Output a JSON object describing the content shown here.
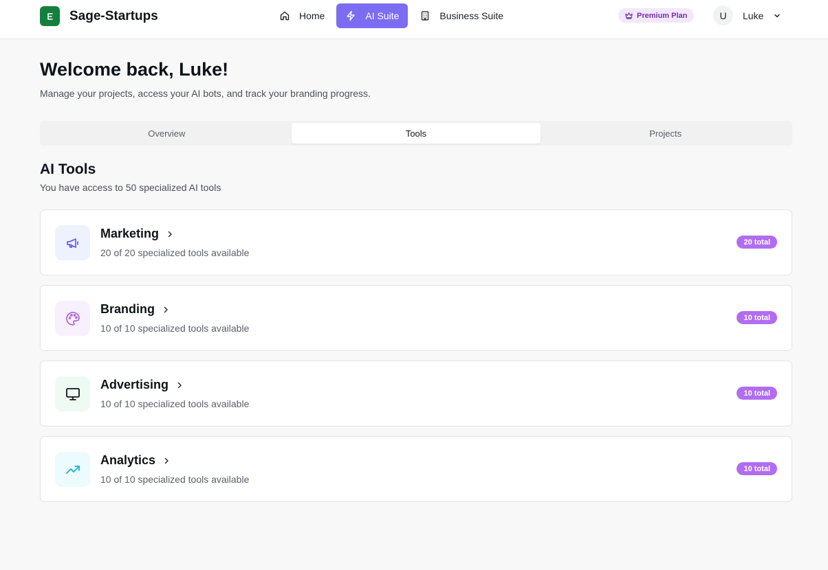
{
  "app": {
    "name": "Sage-Startups"
  },
  "nav": {
    "items": [
      {
        "label": "Home",
        "icon": "home-icon",
        "active": false
      },
      {
        "label": "AI Suite",
        "icon": "lightning-icon",
        "active": true
      },
      {
        "label": "Business Suite",
        "icon": "building-icon",
        "active": false
      }
    ]
  },
  "plan": {
    "label": "Premium Plan",
    "icon": "crown-icon"
  },
  "user": {
    "initial": "U",
    "name": "Luke"
  },
  "welcome": {
    "title": "Welcome back, Luke!",
    "subtitle": "Manage your projects, access your AI bots, and track your branding progress."
  },
  "tabs": [
    {
      "label": "Overview",
      "active": false
    },
    {
      "label": "Tools",
      "active": true
    },
    {
      "label": "Projects",
      "active": false
    }
  ],
  "section": {
    "title": "AI Tools",
    "subtitle": "You have access to 50 specialized AI tools"
  },
  "categories": [
    {
      "title": "Marketing",
      "subtitle": "20 of 20 specialized tools available",
      "badge": "20 total",
      "icon": "megaphone-icon",
      "icon_color": "#6d5ef0",
      "icon_bg": "#eef2fe"
    },
    {
      "title": "Branding",
      "subtitle": "10 of 10 specialized tools available",
      "badge": "10 total",
      "icon": "palette-icon",
      "icon_color": "#b56ad9",
      "icon_bg": "#f8f0fd"
    },
    {
      "title": "Advertising",
      "subtitle": "10 of 10 specialized tools available",
      "badge": "10 total",
      "icon": "monitor-icon",
      "icon_color": "#111418",
      "icon_bg": "#eefaf2"
    },
    {
      "title": "Analytics",
      "subtitle": "10 of 10 specialized tools available",
      "badge": "10 total",
      "icon": "trending-up-icon",
      "icon_color": "#17b3c4",
      "icon_bg": "#ecfbfd"
    }
  ],
  "colors": {
    "accent": "#7c6cf2",
    "brand": "#15803d",
    "badge": "#b16df0",
    "premium_bg": "#f1e9fb",
    "premium_text": "#7a2ea8"
  }
}
